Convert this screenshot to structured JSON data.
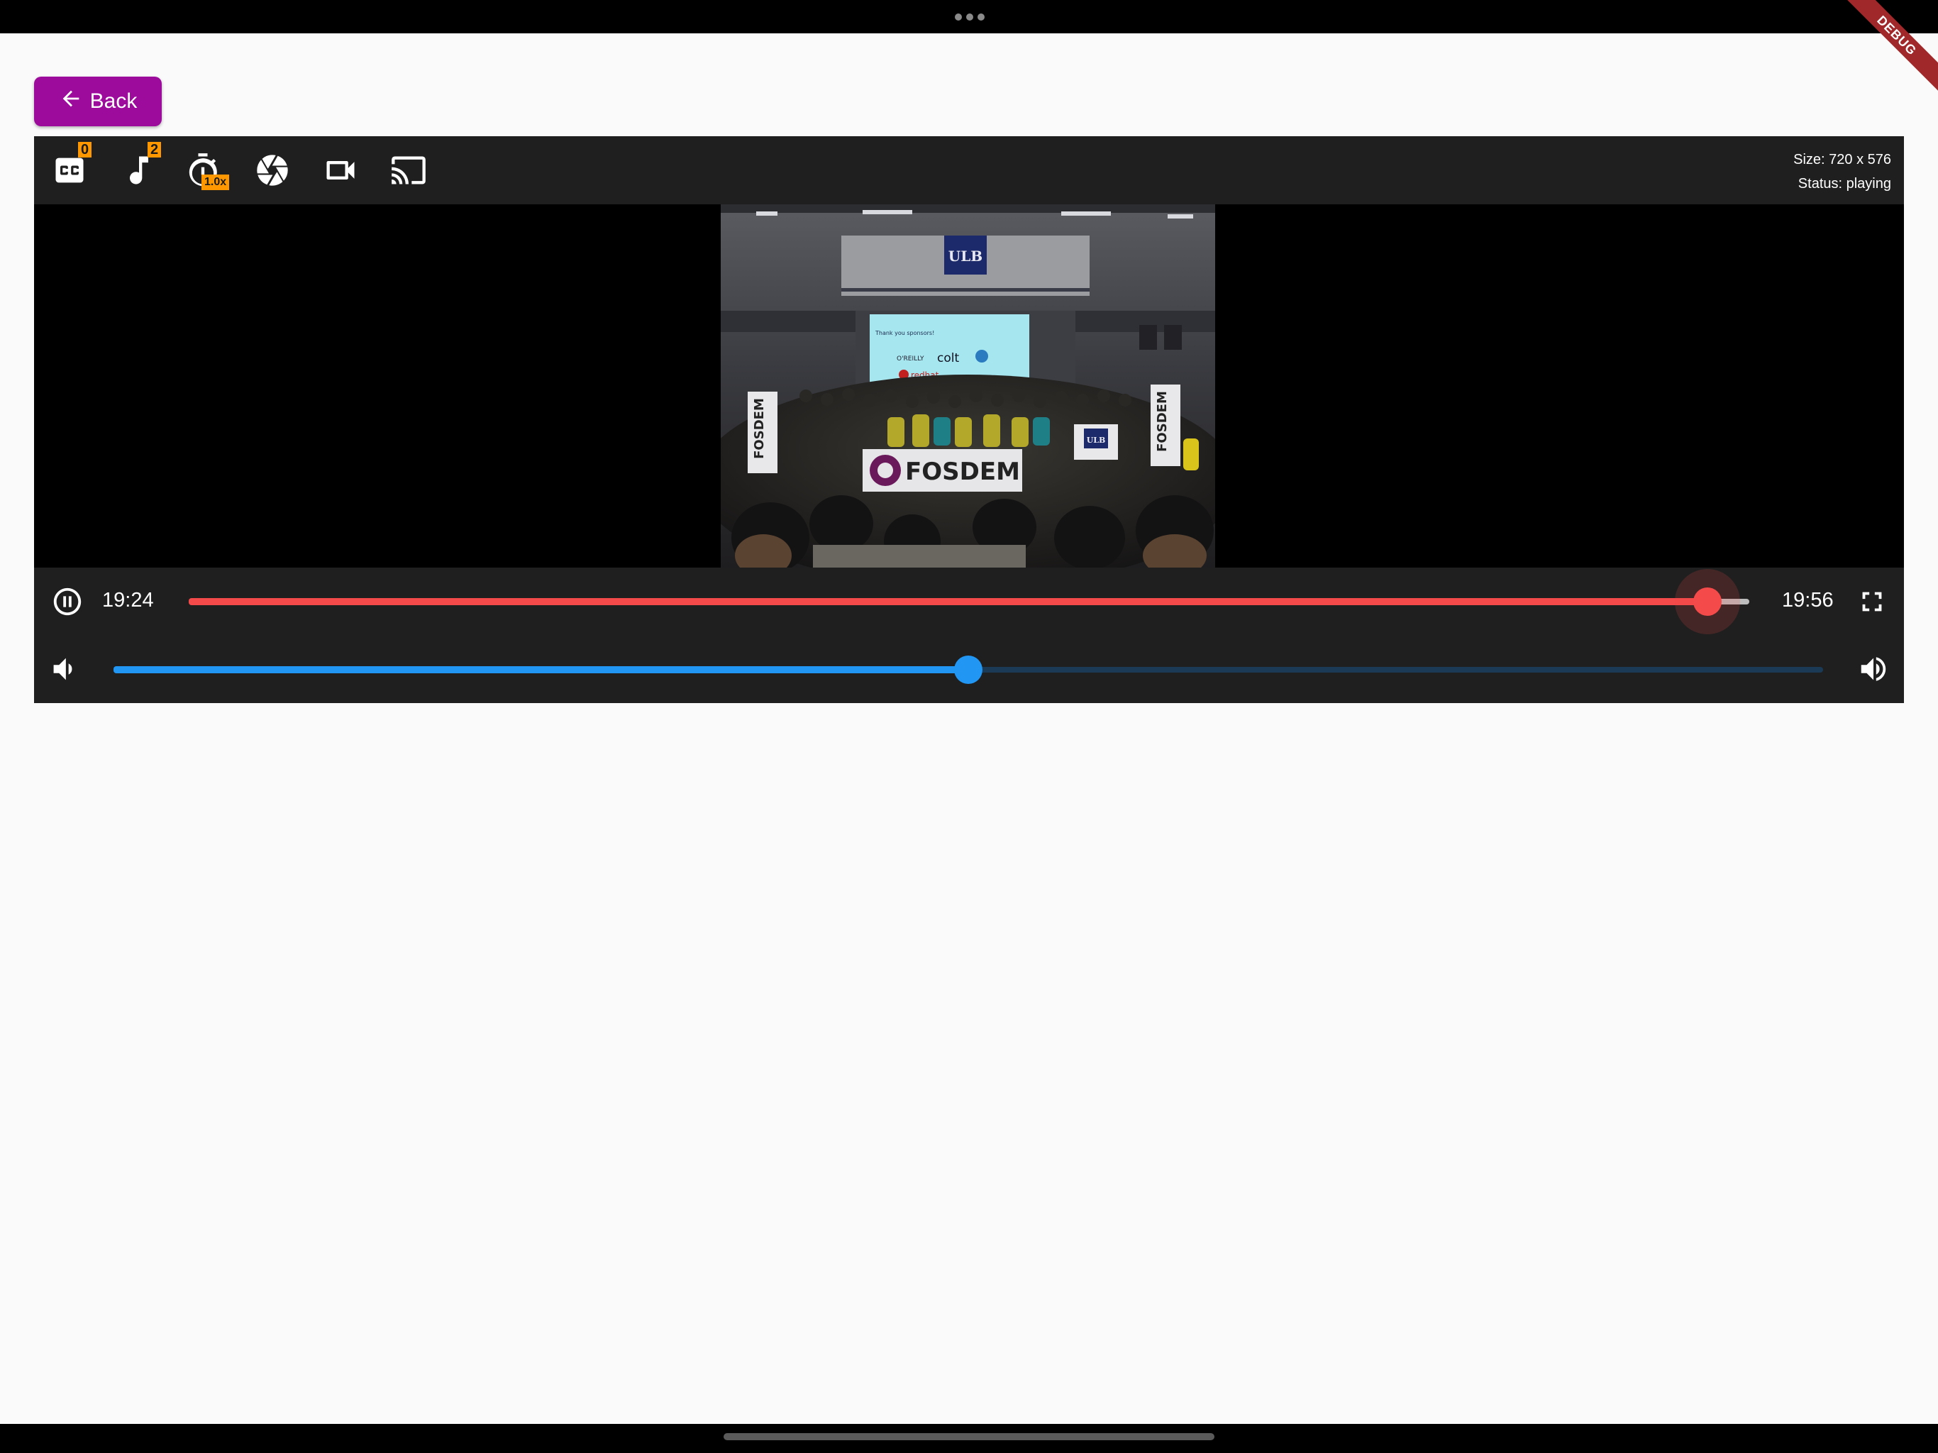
{
  "debug_banner": {
    "label": "DEBUG"
  },
  "back_button": {
    "label": "Back"
  },
  "toolbar": {
    "subtitles_count": "0",
    "audio_tracks_count": "2",
    "playback_speed": "1.0x"
  },
  "info": {
    "size": "Size: 720 x 576",
    "status": "Status: playing"
  },
  "video": {
    "ulb_sign": "ULB",
    "banner_text": "FOSDEM",
    "screen_heading": "Thank you sponsors!",
    "sponsor_oreilly": "O'REILLY",
    "sponsor_colt": "colt",
    "sponsor_redhat": "redhat",
    "side_banner_text": "FOSDEM",
    "podium_sign": "ULB"
  },
  "playback": {
    "position": "19:24",
    "duration": "19:56",
    "progress_fraction": 0.973,
    "volume_fraction": 0.5
  },
  "colors": {
    "accent_progress": "#f44a4a",
    "accent_volume": "#2196f3",
    "back_button": "#9c0b9c",
    "badge": "#ff9800"
  },
  "icons": [
    "closed-caption-icon",
    "music-note-icon",
    "timer-icon",
    "camera-shutter-icon",
    "videocam-icon",
    "cast-icon",
    "pause-icon",
    "fullscreen-icon",
    "volume-down-icon",
    "volume-up-icon",
    "arrow-back-icon"
  ]
}
